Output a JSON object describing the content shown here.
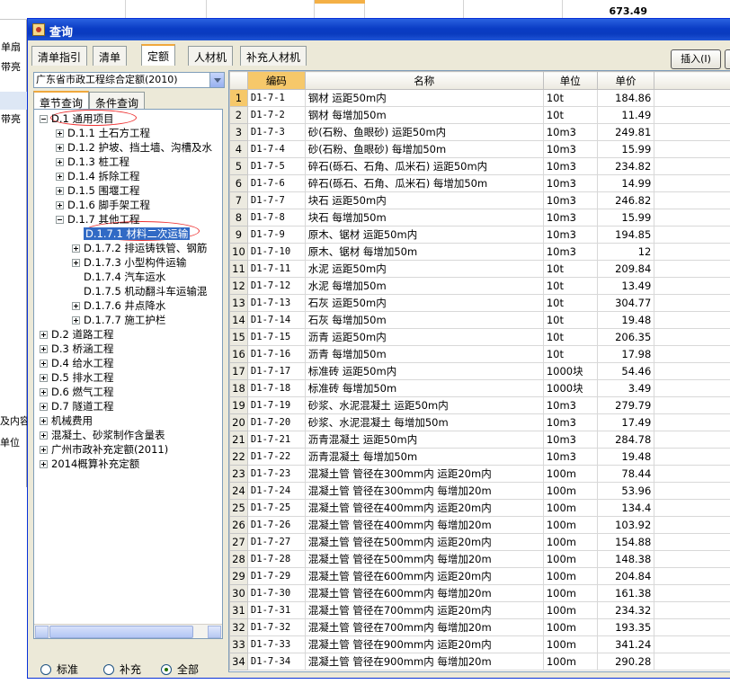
{
  "background": {
    "total": "673.49",
    "left_labels": [
      "单扇",
      "带亮",
      "带亮"
    ],
    "bottom_labels": [
      "及内容",
      "单位"
    ]
  },
  "dialog": {
    "title": "查询",
    "tabs": [
      "清单指引",
      "清单",
      "定额",
      "人材机",
      "补充人材机"
    ],
    "active_tab": "定额",
    "insert_button": "插入(I)"
  },
  "left": {
    "combo_value": "广东省市政工程综合定额(2010)",
    "subtabs": [
      "章节查询",
      "条件查询"
    ],
    "tree": [
      {
        "label": "D.1 通用项目",
        "level": 0,
        "exp": "minus"
      },
      {
        "label": "D.1.1 土石方工程",
        "level": 1,
        "exp": "plus"
      },
      {
        "label": "D.1.2 护坡、挡土墙、沟槽及水",
        "level": 1,
        "exp": "plus"
      },
      {
        "label": "D.1.3 桩工程",
        "level": 1,
        "exp": "plus"
      },
      {
        "label": "D.1.4  拆除工程",
        "level": 1,
        "exp": "plus"
      },
      {
        "label": "D.1.5 围堰工程",
        "level": 1,
        "exp": "plus"
      },
      {
        "label": "D.1.6 脚手架工程",
        "level": 1,
        "exp": "plus"
      },
      {
        "label": "D.1.7 其他工程",
        "level": 1,
        "exp": "minus"
      },
      {
        "label": "D.1.7.1 材料二次运输",
        "level": 2,
        "exp": "none",
        "selected": true
      },
      {
        "label": "D.1.7.2 排运铸铁管、钢筋",
        "level": 2,
        "exp": "plus"
      },
      {
        "label": "D.1.7.3 小型构件运输",
        "level": 2,
        "exp": "plus"
      },
      {
        "label": "D.1.7.4 汽车运水",
        "level": 2,
        "exp": "none"
      },
      {
        "label": "D.1.7.5 机动翻斗车运输混",
        "level": 2,
        "exp": "none"
      },
      {
        "label": "D.1.7.6 井点降水",
        "level": 2,
        "exp": "plus"
      },
      {
        "label": "D.1.7.7 施工护栏",
        "level": 2,
        "exp": "plus"
      },
      {
        "label": "D.2 道路工程",
        "level": 0,
        "exp": "plus"
      },
      {
        "label": "D.3 桥涵工程",
        "level": 0,
        "exp": "plus"
      },
      {
        "label": "D.4 给水工程",
        "level": 0,
        "exp": "plus"
      },
      {
        "label": "D.5 排水工程",
        "level": 0,
        "exp": "plus"
      },
      {
        "label": "D.6 燃气工程",
        "level": 0,
        "exp": "plus"
      },
      {
        "label": "D.7 隧道工程",
        "level": 0,
        "exp": "plus"
      },
      {
        "label": "机械费用",
        "level": 0,
        "exp": "plus"
      },
      {
        "label": "混凝土、砂浆制作含量表",
        "level": 0,
        "exp": "plus"
      },
      {
        "label": "广州市政补充定额(2011)",
        "level": 0,
        "exp": "plus"
      },
      {
        "label": "2014概算补充定额",
        "level": 0,
        "exp": "plus"
      }
    ],
    "radios": [
      {
        "label": "标准",
        "checked": false
      },
      {
        "label": "补充",
        "checked": false
      },
      {
        "label": "全部",
        "checked": true
      }
    ]
  },
  "table": {
    "headers": [
      "编码",
      "名称",
      "单位",
      "单价"
    ],
    "rows": [
      [
        "D1-7-1",
        "钢材 运距50m内",
        "10t",
        "184.86"
      ],
      [
        "D1-7-2",
        "钢材 每增加50m",
        "10t",
        "11.49"
      ],
      [
        "D1-7-3",
        "砂(石粉、鱼眼砂) 运距50m内",
        "10m3",
        "249.81"
      ],
      [
        "D1-7-4",
        "砂(石粉、鱼眼砂) 每增加50m",
        "10m3",
        "15.99"
      ],
      [
        "D1-7-5",
        "碎石(砾石、石角、瓜米石) 运距50m内",
        "10m3",
        "234.82"
      ],
      [
        "D1-7-6",
        "碎石(砾石、石角、瓜米石) 每增加50m",
        "10m3",
        "14.99"
      ],
      [
        "D1-7-7",
        "块石 运距50m内",
        "10m3",
        "246.82"
      ],
      [
        "D1-7-8",
        "块石 每增加50m",
        "10m3",
        "15.99"
      ],
      [
        "D1-7-9",
        "原木、锯材 运距50m内",
        "10m3",
        "194.85"
      ],
      [
        "D1-7-10",
        "原木、锯材 每增加50m",
        "10m3",
        "12"
      ],
      [
        "D1-7-11",
        "水泥 运距50m内",
        "10t",
        "209.84"
      ],
      [
        "D1-7-12",
        "水泥 每增加50m",
        "10t",
        "13.49"
      ],
      [
        "D1-7-13",
        "石灰 运距50m内",
        "10t",
        "304.77"
      ],
      [
        "D1-7-14",
        "石灰 每增加50m",
        "10t",
        "19.48"
      ],
      [
        "D1-7-15",
        "沥青 运距50m内",
        "10t",
        "206.35"
      ],
      [
        "D1-7-16",
        "沥青 每增加50m",
        "10t",
        "17.98"
      ],
      [
        "D1-7-17",
        "标准砖 运距50m内",
        "1000块",
        "54.46"
      ],
      [
        "D1-7-18",
        "标准砖 每增加50m",
        "1000块",
        "3.49"
      ],
      [
        "D1-7-19",
        "砂浆、水泥混凝土 运距50m内",
        "10m3",
        "279.79"
      ],
      [
        "D1-7-20",
        "砂浆、水泥混凝土 每增加50m",
        "10m3",
        "17.49"
      ],
      [
        "D1-7-21",
        "沥青混凝土 运距50m内",
        "10m3",
        "284.78"
      ],
      [
        "D1-7-22",
        "沥青混凝土 每增加50m",
        "10m3",
        "19.48"
      ],
      [
        "D1-7-23",
        "混凝土管 管径在300mm内 运距20m内",
        "100m",
        "78.44"
      ],
      [
        "D1-7-24",
        "混凝土管 管径在300mm内 每增加20m",
        "100m",
        "53.96"
      ],
      [
        "D1-7-25",
        "混凝土管 管径在400mm内 运距20m内",
        "100m",
        "134.4"
      ],
      [
        "D1-7-26",
        "混凝土管 管径在400mm内 每增加20m",
        "100m",
        "103.92"
      ],
      [
        "D1-7-27",
        "混凝土管 管径在500mm内 运距20m内",
        "100m",
        "154.88"
      ],
      [
        "D1-7-28",
        "混凝土管 管径在500mm内 每增加20m",
        "100m",
        "148.38"
      ],
      [
        "D1-7-29",
        "混凝土管 管径在600mm内 运距20m内",
        "100m",
        "204.84"
      ],
      [
        "D1-7-30",
        "混凝土管 管径在600mm内 每增加20m",
        "100m",
        "161.38"
      ],
      [
        "D1-7-31",
        "混凝土管 管径在700mm内 运距20m内",
        "100m",
        "234.32"
      ],
      [
        "D1-7-32",
        "混凝土管 管径在700mm内 每增加20m",
        "100m",
        "193.35"
      ],
      [
        "D1-7-33",
        "混凝土管 管径在900mm内 运距20m内",
        "100m",
        "341.24"
      ],
      [
        "D1-7-34",
        "混凝土管 管径在900mm内 每增加20m",
        "100m",
        "290.28"
      ]
    ]
  },
  "colors": {
    "title_bar": "#0a3cc4",
    "selection": "#316ac5",
    "header_highlight": "#f6c86a",
    "annotation_circle": "#ee3333"
  }
}
